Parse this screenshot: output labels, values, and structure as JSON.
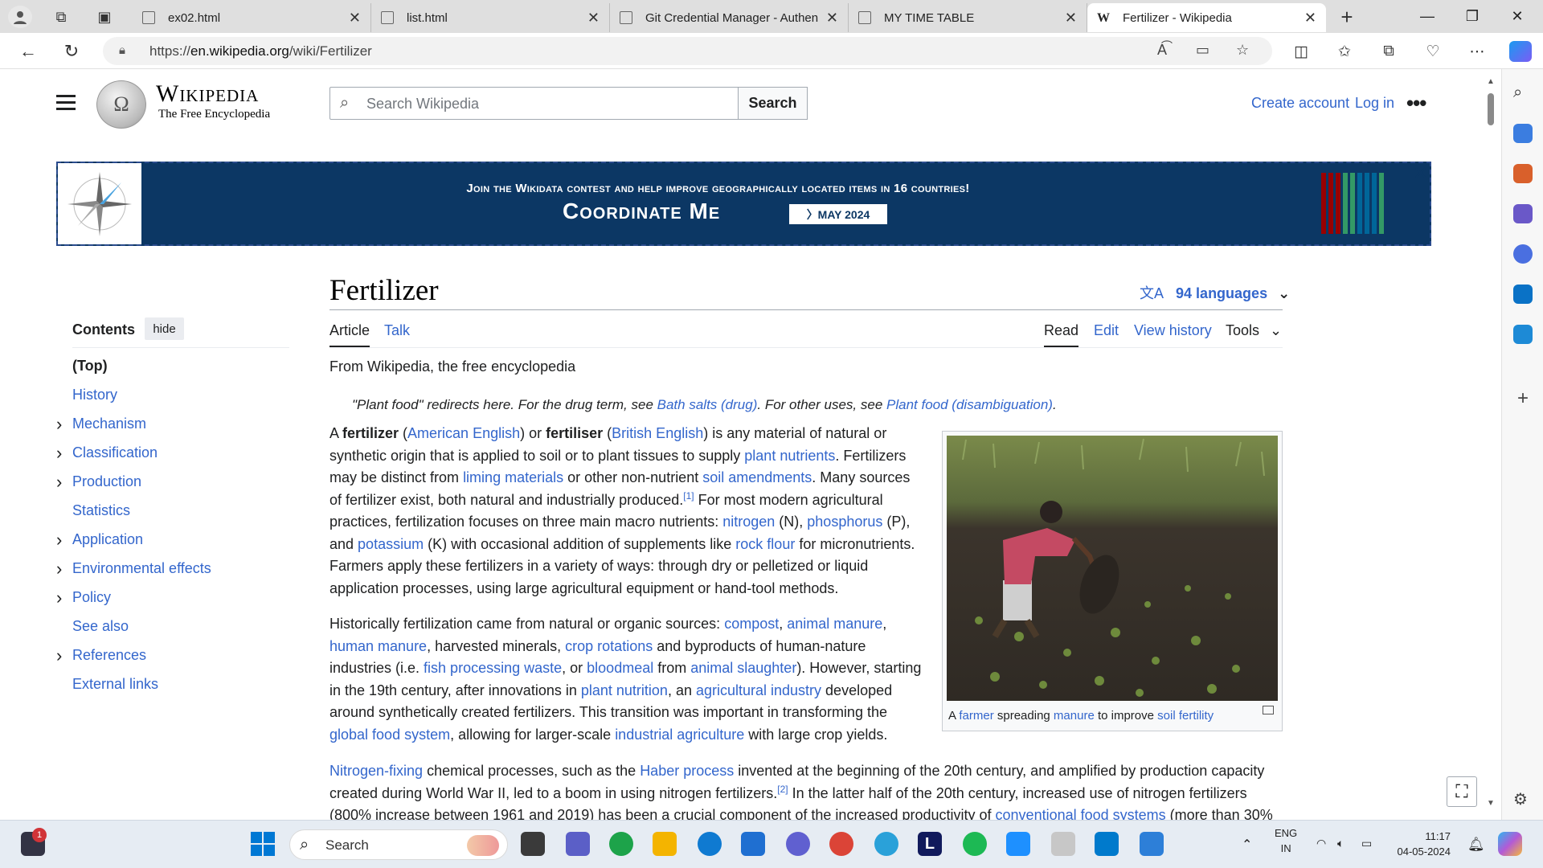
{
  "browser": {
    "tabs": [
      {
        "title": "ex02.html"
      },
      {
        "title": "list.html"
      },
      {
        "title": "Git Credential Manager - Authen"
      },
      {
        "title": "MY TIME TABLE"
      },
      {
        "title": "Fertilizer - Wikipedia",
        "active": true,
        "favicon": "W"
      }
    ],
    "new_tab_label": "+",
    "url_prefix": "https://",
    "url_host": "en.wikipedia.org",
    "url_path": "/wiki/Fertilizer"
  },
  "wiki": {
    "wordmark": "Wikipedia",
    "tagline": "The Free Encyclopedia",
    "search_placeholder": "Search Wikipedia",
    "search_button": "Search",
    "create_account": "Create account",
    "log_in": "Log in",
    "more": "•••"
  },
  "banner": {
    "line1": "Join the Wikidata contest and help improve geographically located items in 16 countries!",
    "line2": "Coordinate Me",
    "pill": "〉MAY 2024",
    "close": "✕",
    "bar_colors": [
      "#990000",
      "#990000",
      "#990000",
      "#339966",
      "#339966",
      "#006699",
      "#006699",
      "#006699",
      "#339966"
    ]
  },
  "toc": {
    "heading": "Contents",
    "hide": "hide",
    "items": [
      {
        "label": "(Top)",
        "expand": false
      },
      {
        "label": "History",
        "expand": false
      },
      {
        "label": "Mechanism",
        "expand": true
      },
      {
        "label": "Classification",
        "expand": true
      },
      {
        "label": "Production",
        "expand": true
      },
      {
        "label": "Statistics",
        "expand": false
      },
      {
        "label": "Application",
        "expand": true
      },
      {
        "label": "Environmental effects",
        "expand": true
      },
      {
        "label": "Policy",
        "expand": true
      },
      {
        "label": "See also",
        "expand": false
      },
      {
        "label": "References",
        "expand": true
      },
      {
        "label": "External links",
        "expand": false
      }
    ]
  },
  "article": {
    "title": "Fertilizer",
    "languages": "94 languages",
    "tab_article": "Article",
    "tab_talk": "Talk",
    "tab_read": "Read",
    "tab_edit": "Edit",
    "tab_history": "View history",
    "tab_tools": "Tools",
    "from": "From Wikipedia, the free encyclopedia",
    "hatnote": {
      "a": "\"Plant food\" redirects here. For the drug term, see ",
      "l1": "Bath salts (drug)",
      "b": ". For other uses, see ",
      "l2": "Plant food (disambiguation)",
      "c": "."
    },
    "figure_caption": {
      "a": "A ",
      "l1": "farmer",
      "b": " spreading ",
      "l2": "manure",
      "c": " to improve ",
      "l3": "soil fertility"
    }
  },
  "taskbar": {
    "search": "Search",
    "notif_count": "1",
    "lang_top": "ENG",
    "lang_bottom": "IN",
    "time": "11:17",
    "date": "04-05-2024"
  }
}
